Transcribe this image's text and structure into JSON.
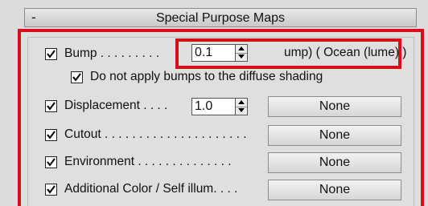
{
  "rollout": {
    "toggle": "-",
    "title": "Special Purpose Maps"
  },
  "rows": [
    {
      "label": "Bump . . . . . . . . .",
      "checked": true,
      "amount": "0.1",
      "map": "ump)  ( Ocean (lume) )"
    },
    {
      "label": "Do not apply bumps to the diffuse shading",
      "checked": true
    },
    {
      "label": "Displacement . . . .",
      "checked": true,
      "amount": "1.0",
      "map": "None"
    },
    {
      "label": "Cutout . . . . . . . . . . . . . . . . . . . . .",
      "checked": true,
      "map": "None"
    },
    {
      "label": "Environment . . . . . . . . . . . . . .",
      "checked": true,
      "map": "None"
    },
    {
      "label": "Additional Color / Self illum. . . .",
      "checked": true,
      "map": "None"
    }
  ],
  "colors": {
    "highlight": "#d3101a",
    "panel": "#dfdfdf"
  }
}
